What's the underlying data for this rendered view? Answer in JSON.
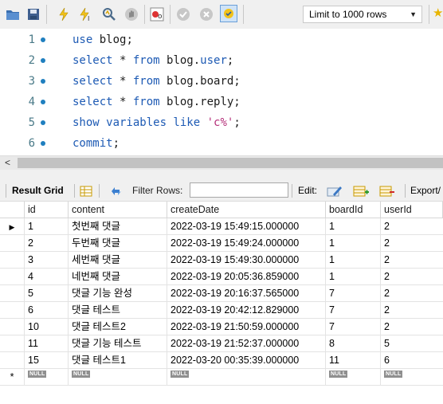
{
  "toolbar": {
    "limit_value": "Limit to 1000 rows",
    "icons": [
      "open-folder-icon",
      "save-icon",
      "execute-icon",
      "execute-current-icon",
      "explain-icon",
      "stop-icon",
      "toggle-continue-on-error-icon",
      "commit-icon",
      "rollback-icon",
      "autocommit-icon",
      "star-icon"
    ]
  },
  "editor": {
    "lines": [
      {
        "num": "1",
        "parts": [
          {
            "t": "use",
            "c": "kw"
          },
          {
            "t": " blog;",
            "c": "plain"
          }
        ]
      },
      {
        "num": "2",
        "parts": [
          {
            "t": "select",
            "c": "kw"
          },
          {
            "t": " * ",
            "c": "plain"
          },
          {
            "t": "from",
            "c": "kw"
          },
          {
            "t": " blog.",
            "c": "plain"
          },
          {
            "t": "user",
            "c": "kw"
          },
          {
            "t": ";",
            "c": "plain"
          }
        ]
      },
      {
        "num": "3",
        "parts": [
          {
            "t": "select",
            "c": "kw"
          },
          {
            "t": " * ",
            "c": "plain"
          },
          {
            "t": "from",
            "c": "kw"
          },
          {
            "t": " blog.board;",
            "c": "plain"
          }
        ]
      },
      {
        "num": "4",
        "parts": [
          {
            "t": "select",
            "c": "kw"
          },
          {
            "t": " * ",
            "c": "plain"
          },
          {
            "t": "from",
            "c": "kw"
          },
          {
            "t": " blog.reply;",
            "c": "plain"
          }
        ]
      },
      {
        "num": "5",
        "parts": [
          {
            "t": "show variables like",
            "c": "kw"
          },
          {
            "t": " ",
            "c": "plain"
          },
          {
            "t": "'c%'",
            "c": "str"
          },
          {
            "t": ";",
            "c": "plain"
          }
        ]
      },
      {
        "num": "6",
        "parts": [
          {
            "t": "commit",
            "c": "kw"
          },
          {
            "t": ";",
            "c": "plain"
          }
        ]
      }
    ]
  },
  "result_toolbar": {
    "result_grid_label": "Result Grid",
    "filter_rows_label": "Filter Rows:",
    "filter_value": "",
    "edit_label": "Edit:",
    "export_label": "Export/"
  },
  "grid": {
    "columns": [
      "id",
      "content",
      "createDate",
      "boardId",
      "userId"
    ],
    "rows": [
      [
        "1",
        "첫번째 댓글",
        "2022-03-19 15:49:15.000000",
        "1",
        "2"
      ],
      [
        "2",
        "두번째 댓글",
        "2022-03-19 15:49:24.000000",
        "1",
        "2"
      ],
      [
        "3",
        "세번째 댓글",
        "2022-03-19 15:49:30.000000",
        "1",
        "2"
      ],
      [
        "4",
        "네번째 댓글",
        "2022-03-19 20:05:36.859000",
        "1",
        "2"
      ],
      [
        "5",
        "댓글 기능 완성",
        "2022-03-19 20:16:37.565000",
        "7",
        "2"
      ],
      [
        "6",
        "댓글 테스트",
        "2022-03-19 20:42:12.829000",
        "7",
        "2"
      ],
      [
        "10",
        "댓글 테스트2",
        "2022-03-19 21:50:59.000000",
        "7",
        "2"
      ],
      [
        "11",
        "댓글 기능 테스트",
        "2022-03-19 21:52:37.000000",
        "8",
        "5"
      ],
      [
        "15",
        "댓글 테스트1",
        "2022-03-20 00:35:39.000000",
        "11",
        "6"
      ]
    ],
    "null_label": "NULL"
  }
}
